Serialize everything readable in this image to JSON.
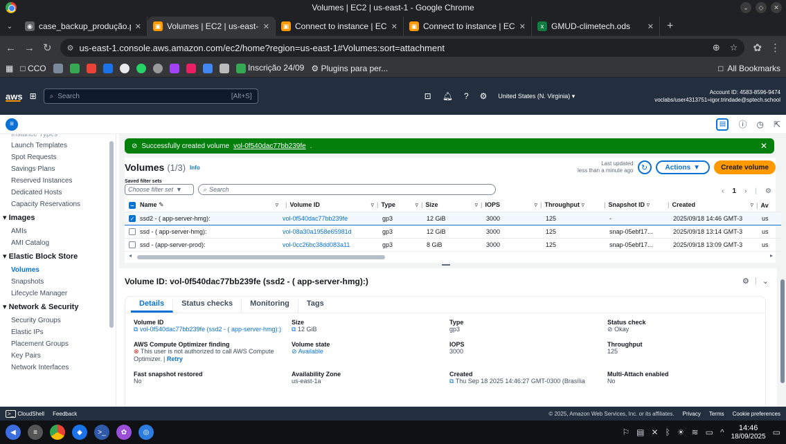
{
  "window": {
    "title": "Volumes | EC2 | us-east-1 - Google Chrome"
  },
  "tabs": [
    {
      "label": "case_backup_produção.pdf",
      "active": false
    },
    {
      "label": "Volumes | EC2 | us-east-1",
      "active": true
    },
    {
      "label": "Connect to instance | EC2",
      "active": false
    },
    {
      "label": "Connect to instance | EC2",
      "active": false
    },
    {
      "label": "GMUD-climetech.ods",
      "active": false
    }
  ],
  "address": {
    "url": "us-east-1.console.aws.amazon.com/ec2/home?region=us-east-1#Volumes:sort=attachment"
  },
  "bookmarks": {
    "folder": "CCO",
    "item1": "Inscrição 24/09",
    "item2": "Plugins para per...",
    "all": "All Bookmarks"
  },
  "aws": {
    "logo": "aws",
    "search_placeholder": "Search",
    "search_shortcut": "[Alt+S]",
    "region": "United States (N. Virginia) ▾",
    "account_id": "Account ID: 4583-8596-9474",
    "account_user": "voclabs/user4313751=igor.trindade@sptech.school"
  },
  "sidebar": {
    "top_partial": "Instance Types",
    "items_a": [
      "Launch Templates",
      "Spot Requests",
      "Savings Plans",
      "Reserved Instances",
      "Dedicated Hosts",
      "Capacity Reservations"
    ],
    "sect_images": "▾ Images",
    "items_images": [
      "AMIs",
      "AMI Catalog"
    ],
    "sect_ebs": "▾ Elastic Block Store",
    "items_ebs": [
      "Volumes",
      "Snapshots",
      "Lifecycle Manager"
    ],
    "sect_net": "▾ Network & Security",
    "items_net": [
      "Security Groups",
      "Elastic IPs",
      "Placement Groups",
      "Key Pairs",
      "Network Interfaces"
    ]
  },
  "flash": {
    "text": "Successfully created volume",
    "volume": "vol-0f540dac77bb239fe",
    "dot": "."
  },
  "volumes": {
    "title": "Volumes",
    "count": "(1/3)",
    "info": "Info",
    "updated_1": "Last updated",
    "updated_2": "less than a minute ago",
    "actions": "Actions",
    "create": "Create volume",
    "filter_label": "Saved filter sets",
    "filter_placeholder": "Choose filter set",
    "search_placeholder": "Search",
    "page": "1",
    "columns": [
      "Name",
      "Volume ID",
      "Type",
      "Size",
      "IOPS",
      "Throughput",
      "Snapshot ID",
      "Created",
      "Av"
    ],
    "rows": [
      {
        "name": "ssd2 - ( app-server-hmg):",
        "id": "vol-0f540dac77bb239fe",
        "type": "gp3",
        "size": "12 GiB",
        "iops": "3000",
        "throughput": "125",
        "snapshot": "-",
        "created": "2025/09/18 14:46 GMT-3",
        "az": "us",
        "selected": true
      },
      {
        "name": "ssd - ( app-server-hmg):",
        "id": "vol-08a30a1958e65981d",
        "type": "gp3",
        "size": "12 GiB",
        "iops": "3000",
        "throughput": "125",
        "snapshot": "snap-05ebf17...",
        "created": "2025/09/18 13:14 GMT-3",
        "az": "us",
        "selected": false
      },
      {
        "name": "ssd - (app-server-prod):",
        "id": "vol-0cc26bc38dd083a11",
        "type": "gp3",
        "size": "8 GiB",
        "iops": "3000",
        "throughput": "125",
        "snapshot": "snap-05ebf17...",
        "created": "2025/09/18 13:09 GMT-3",
        "az": "us",
        "selected": false
      }
    ]
  },
  "detail": {
    "title": "Volume ID: vol-0f540dac77bb239fe (ssd2 - ( app-server-hmg):)",
    "tabs": [
      "Details",
      "Status checks",
      "Monitoring",
      "Tags"
    ],
    "fields": {
      "volume_id_k": "Volume ID",
      "volume_id_v": "vol-0f540dac77bb239fe (ssd2 - ( app-server-hmg):)",
      "size_k": "Size",
      "size_v": "12 GiB",
      "type_k": "Type",
      "type_v": "gp3",
      "status_k": "Status check",
      "status_v": "Okay",
      "optimizer_k": "AWS Compute Optimizer finding",
      "optimizer_v": "This user is not authorized to call AWS Compute Optimizer.",
      "optimizer_retry": "Retry",
      "state_k": "Volume state",
      "state_v": "Available",
      "iops_k": "IOPS",
      "iops_v": "3000",
      "throughput_k": "Throughput",
      "throughput_v": "125",
      "fast_k": "Fast snapshot restored",
      "fast_v": "No",
      "az_k": "Availability Zone",
      "az_v": "us-east-1a",
      "created_k": "Created",
      "created_v": "Thu Sep 18 2025 14:46:27 GMT-0300 (Brasília",
      "multi_k": "Multi-Attach enabled",
      "multi_v": "No"
    }
  },
  "footer": {
    "cloudshell": "CloudShell",
    "feedback": "Feedback",
    "copyright": "© 2025, Amazon Web Services, Inc. or its affiliates.",
    "privacy": "Privacy",
    "terms": "Terms",
    "cookies": "Cookie preferences"
  },
  "taskbar": {
    "time": "14:46",
    "date": "18/09/2025"
  },
  "colors": {
    "aws_nav": "#232f3e",
    "accent": "#0972d3",
    "success": "#037f0c",
    "orange": "#ff9900"
  }
}
